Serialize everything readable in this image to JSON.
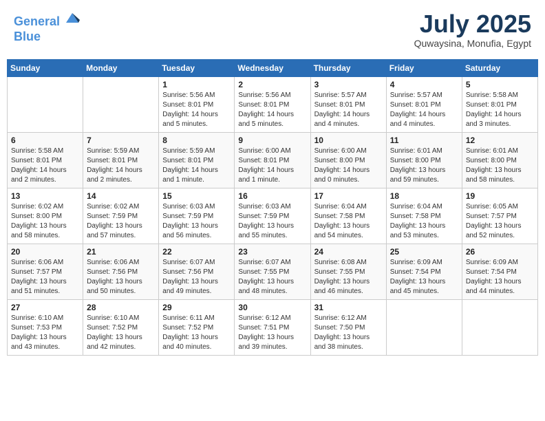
{
  "header": {
    "logo_line1": "General",
    "logo_line2": "Blue",
    "month_title": "July 2025",
    "location": "Quwaysina, Monufia, Egypt"
  },
  "weekdays": [
    "Sunday",
    "Monday",
    "Tuesday",
    "Wednesday",
    "Thursday",
    "Friday",
    "Saturday"
  ],
  "weeks": [
    [
      {
        "day": "",
        "info": ""
      },
      {
        "day": "",
        "info": ""
      },
      {
        "day": "1",
        "info": "Sunrise: 5:56 AM\nSunset: 8:01 PM\nDaylight: 14 hours and 5 minutes."
      },
      {
        "day": "2",
        "info": "Sunrise: 5:56 AM\nSunset: 8:01 PM\nDaylight: 14 hours and 5 minutes."
      },
      {
        "day": "3",
        "info": "Sunrise: 5:57 AM\nSunset: 8:01 PM\nDaylight: 14 hours and 4 minutes."
      },
      {
        "day": "4",
        "info": "Sunrise: 5:57 AM\nSunset: 8:01 PM\nDaylight: 14 hours and 4 minutes."
      },
      {
        "day": "5",
        "info": "Sunrise: 5:58 AM\nSunset: 8:01 PM\nDaylight: 14 hours and 3 minutes."
      }
    ],
    [
      {
        "day": "6",
        "info": "Sunrise: 5:58 AM\nSunset: 8:01 PM\nDaylight: 14 hours and 2 minutes."
      },
      {
        "day": "7",
        "info": "Sunrise: 5:59 AM\nSunset: 8:01 PM\nDaylight: 14 hours and 2 minutes."
      },
      {
        "day": "8",
        "info": "Sunrise: 5:59 AM\nSunset: 8:01 PM\nDaylight: 14 hours and 1 minute."
      },
      {
        "day": "9",
        "info": "Sunrise: 6:00 AM\nSunset: 8:01 PM\nDaylight: 14 hours and 1 minute."
      },
      {
        "day": "10",
        "info": "Sunrise: 6:00 AM\nSunset: 8:00 PM\nDaylight: 14 hours and 0 minutes."
      },
      {
        "day": "11",
        "info": "Sunrise: 6:01 AM\nSunset: 8:00 PM\nDaylight: 13 hours and 59 minutes."
      },
      {
        "day": "12",
        "info": "Sunrise: 6:01 AM\nSunset: 8:00 PM\nDaylight: 13 hours and 58 minutes."
      }
    ],
    [
      {
        "day": "13",
        "info": "Sunrise: 6:02 AM\nSunset: 8:00 PM\nDaylight: 13 hours and 58 minutes."
      },
      {
        "day": "14",
        "info": "Sunrise: 6:02 AM\nSunset: 7:59 PM\nDaylight: 13 hours and 57 minutes."
      },
      {
        "day": "15",
        "info": "Sunrise: 6:03 AM\nSunset: 7:59 PM\nDaylight: 13 hours and 56 minutes."
      },
      {
        "day": "16",
        "info": "Sunrise: 6:03 AM\nSunset: 7:59 PM\nDaylight: 13 hours and 55 minutes."
      },
      {
        "day": "17",
        "info": "Sunrise: 6:04 AM\nSunset: 7:58 PM\nDaylight: 13 hours and 54 minutes."
      },
      {
        "day": "18",
        "info": "Sunrise: 6:04 AM\nSunset: 7:58 PM\nDaylight: 13 hours and 53 minutes."
      },
      {
        "day": "19",
        "info": "Sunrise: 6:05 AM\nSunset: 7:57 PM\nDaylight: 13 hours and 52 minutes."
      }
    ],
    [
      {
        "day": "20",
        "info": "Sunrise: 6:06 AM\nSunset: 7:57 PM\nDaylight: 13 hours and 51 minutes."
      },
      {
        "day": "21",
        "info": "Sunrise: 6:06 AM\nSunset: 7:56 PM\nDaylight: 13 hours and 50 minutes."
      },
      {
        "day": "22",
        "info": "Sunrise: 6:07 AM\nSunset: 7:56 PM\nDaylight: 13 hours and 49 minutes."
      },
      {
        "day": "23",
        "info": "Sunrise: 6:07 AM\nSunset: 7:55 PM\nDaylight: 13 hours and 48 minutes."
      },
      {
        "day": "24",
        "info": "Sunrise: 6:08 AM\nSunset: 7:55 PM\nDaylight: 13 hours and 46 minutes."
      },
      {
        "day": "25",
        "info": "Sunrise: 6:09 AM\nSunset: 7:54 PM\nDaylight: 13 hours and 45 minutes."
      },
      {
        "day": "26",
        "info": "Sunrise: 6:09 AM\nSunset: 7:54 PM\nDaylight: 13 hours and 44 minutes."
      }
    ],
    [
      {
        "day": "27",
        "info": "Sunrise: 6:10 AM\nSunset: 7:53 PM\nDaylight: 13 hours and 43 minutes."
      },
      {
        "day": "28",
        "info": "Sunrise: 6:10 AM\nSunset: 7:52 PM\nDaylight: 13 hours and 42 minutes."
      },
      {
        "day": "29",
        "info": "Sunrise: 6:11 AM\nSunset: 7:52 PM\nDaylight: 13 hours and 40 minutes."
      },
      {
        "day": "30",
        "info": "Sunrise: 6:12 AM\nSunset: 7:51 PM\nDaylight: 13 hours and 39 minutes."
      },
      {
        "day": "31",
        "info": "Sunrise: 6:12 AM\nSunset: 7:50 PM\nDaylight: 13 hours and 38 minutes."
      },
      {
        "day": "",
        "info": ""
      },
      {
        "day": "",
        "info": ""
      }
    ]
  ]
}
